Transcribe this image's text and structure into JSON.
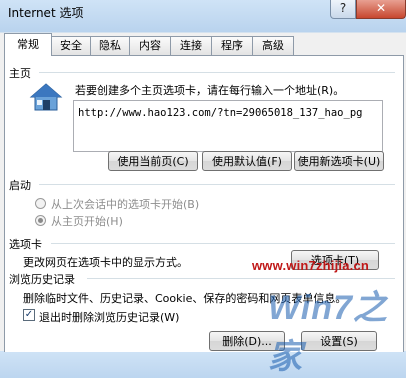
{
  "window": {
    "title": "Internet 选项",
    "help": "?",
    "close": "✕"
  },
  "tabs": [
    {
      "label": "常规"
    },
    {
      "label": "安全"
    },
    {
      "label": "隐私"
    },
    {
      "label": "内容"
    },
    {
      "label": "连接"
    },
    {
      "label": "程序"
    },
    {
      "label": "高级"
    }
  ],
  "home": {
    "group_label": "主页",
    "instruction": "若要创建多个主页选项卡，请在每行输入一个地址(R)。",
    "url": "http://www.hao123.com/?tn=29065018_137_hao_pg",
    "btn_current": "使用当前页(C)",
    "btn_default": "使用默认值(F)",
    "btn_blank": "使用新选项卡(U)"
  },
  "startup": {
    "group_label": "启动",
    "option_last_session": "从上次会话中的选项卡开始(B)",
    "option_home": "从主页开始(H)"
  },
  "tabs_group": {
    "group_label": "选项卡",
    "description": "更改网页在选项卡中的显示方式。",
    "button": "选项卡(T)"
  },
  "history": {
    "group_label": "浏览历史记录",
    "description": "删除临时文件、历史记录、Cookie、保存的密码和网页表单信息。",
    "checkbox_label": "退出时删除浏览历史记录(W)",
    "checkbox_checked": true,
    "btn_delete": "删除(D)...",
    "btn_settings": "设置(S)"
  },
  "watermark": {
    "url": "www.win7zhijia.cn",
    "logo": "Win7之家"
  }
}
